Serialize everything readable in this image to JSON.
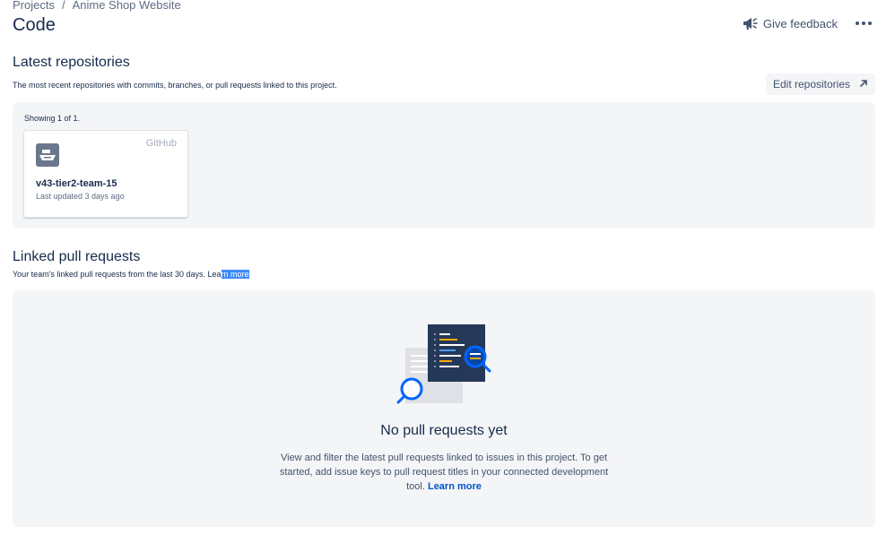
{
  "breadcrumb": {
    "projects": "Projects",
    "separator": "/",
    "project": "Anime Shop Website"
  },
  "page": {
    "title": "Code"
  },
  "actions": {
    "feedback_label": "Give feedback",
    "feedback_icon": "megaphone-icon",
    "more_icon": "more-icon"
  },
  "latest_repos": {
    "title": "Latest repositories",
    "description": "The most recent repositories with commits, branches, or pull requests linked to this project.",
    "edit_label": "Edit repositories",
    "edit_icon": "arrow-up-right-icon",
    "showing": "Showing 1 of 1.",
    "repos": [
      {
        "name": "v43-tier2-team-15",
        "updated": "Last updated 3 days ago",
        "provider": "GitHub",
        "icon": "repository-icon"
      }
    ]
  },
  "linked_prs": {
    "title": "Linked pull requests",
    "description_prefix": "Your team's linked pull requests from the last 30 days. Lea",
    "description_highlight": "rn more",
    "empty_title": "No pull requests yet",
    "empty_desc": "View and filter the latest pull requests linked to issues in this project. To get started, add issue keys to pull request titles in your connected development tool.",
    "empty_link": "Learn more"
  },
  "colors": {
    "text": "#172b4d",
    "subtle": "#5e6c84",
    "panel": "#f4f5f7",
    "link": "#0052cc",
    "highlight": "#3d8bfd",
    "illustration_dark": "#253858",
    "illustration_blue": "#0065ff"
  }
}
